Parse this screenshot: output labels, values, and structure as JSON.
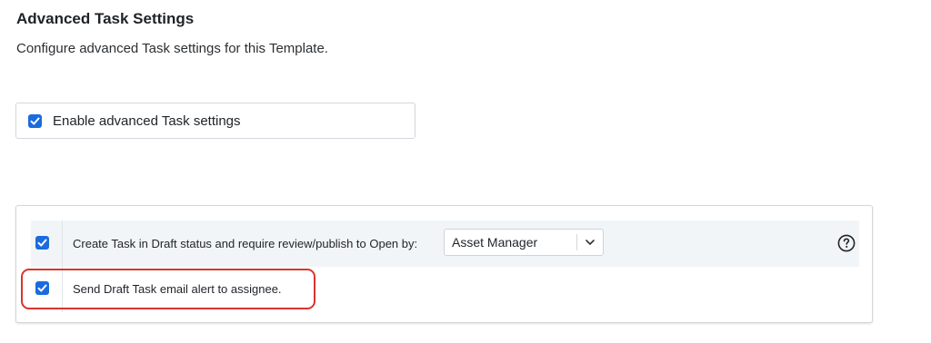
{
  "header": {
    "title": "Advanced Task Settings",
    "subtitle": "Configure advanced Task settings for this Template."
  },
  "enable_option": {
    "label": "Enable advanced Task settings",
    "checked": true
  },
  "panel": {
    "draft_status": {
      "label": "Create Task in Draft status and require review/publish to Open by:",
      "checked": true,
      "select_value": "Asset Manager",
      "chevron_icon": "chevron-down-icon",
      "help_icon": "question-circle-icon"
    },
    "draft_email": {
      "label": "Send Draft Task email alert to assignee.",
      "checked": true
    }
  },
  "colors": {
    "checkbox": "#1b6bdc",
    "highlight": "#d9342b",
    "row_background": "#f2f5f8"
  }
}
